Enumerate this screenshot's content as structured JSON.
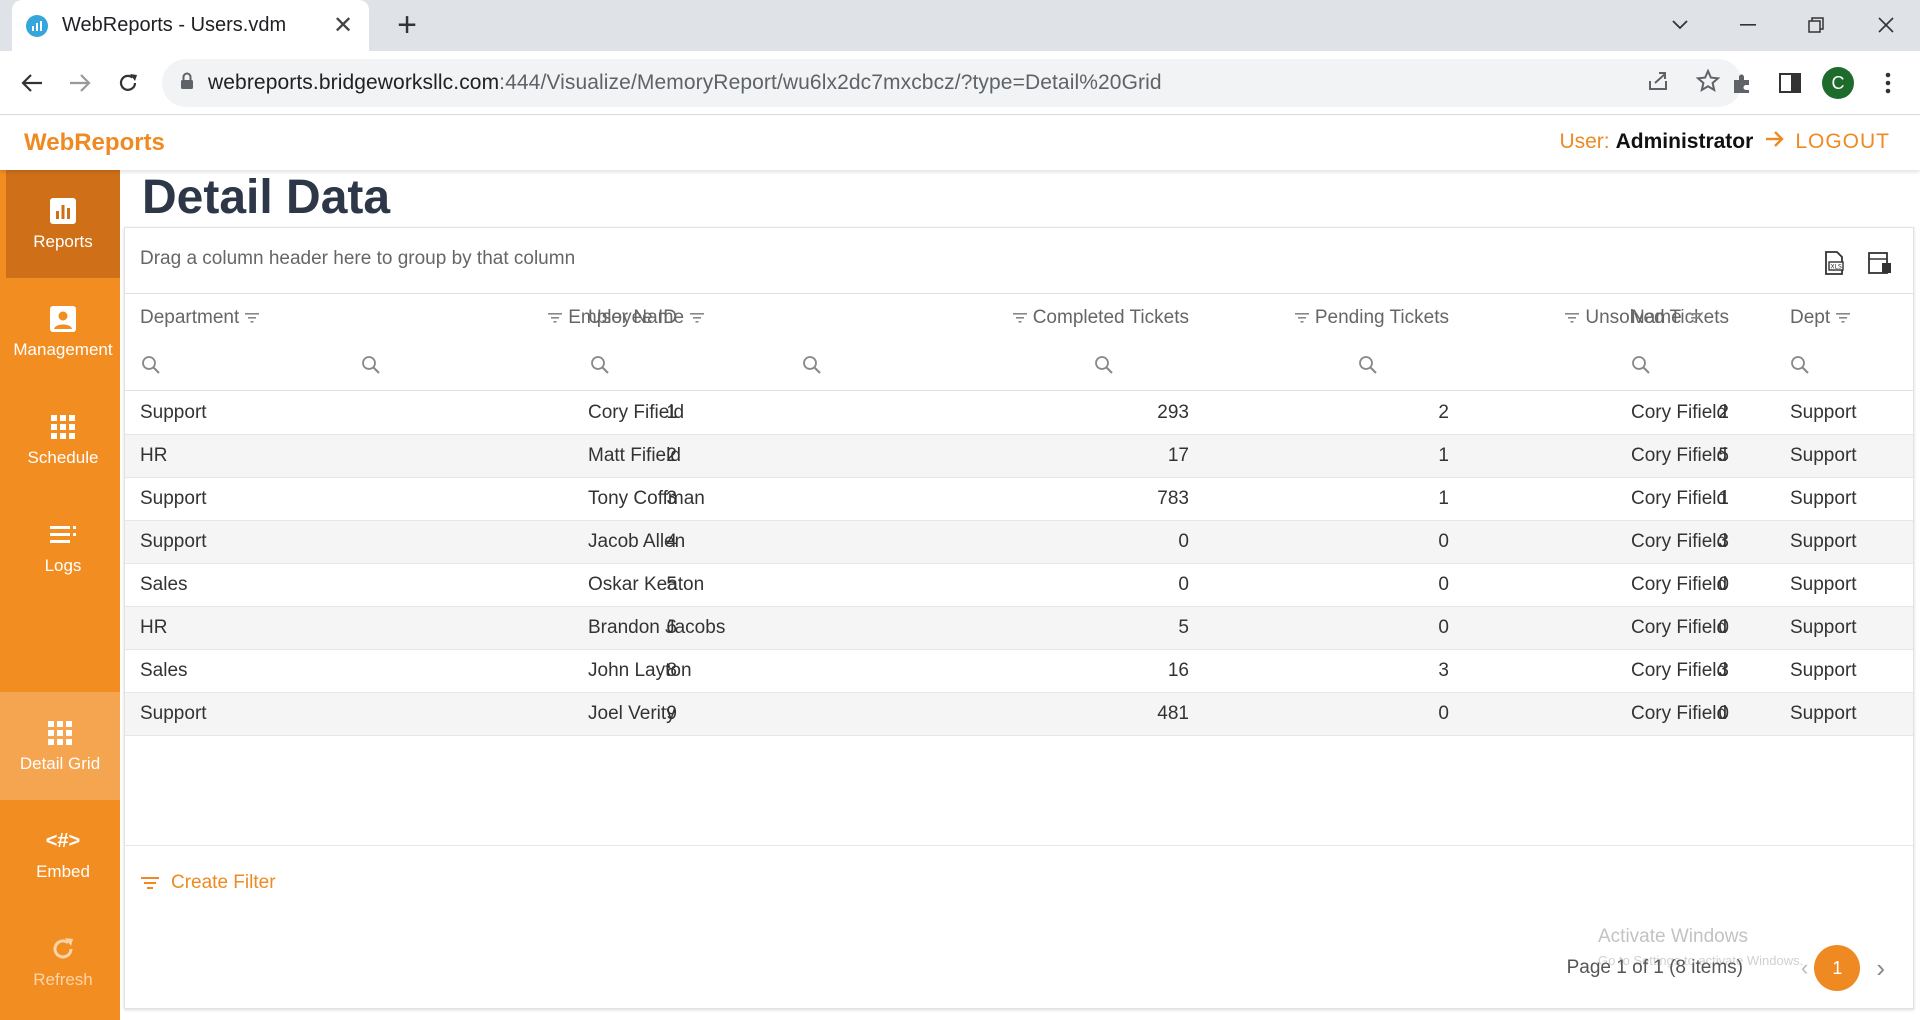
{
  "browser": {
    "tab_title": "WebReports - Users.vdm",
    "url_host": "webreports.bridgeworksllc.com",
    "url_path": ":444/Visualize/MemoryReport/wu6lx2dc7mxcbcz/?type=Detail%20Grid",
    "profile_initial": "C"
  },
  "app": {
    "brand": "WebReports",
    "user_label": "User:",
    "user_name": "Administrator",
    "logout_label": "LOGOUT"
  },
  "sidebar": {
    "items": [
      {
        "label": "Reports",
        "icon": "bar-chart-icon"
      },
      {
        "label": "Management",
        "icon": "account-box-icon"
      },
      {
        "label": "Schedule",
        "icon": "grid-icon"
      },
      {
        "label": "Logs",
        "icon": "list-icon"
      },
      {
        "label": "Detail Grid",
        "icon": "grid-icon"
      },
      {
        "label": "Embed",
        "icon": "embed-code-icon"
      },
      {
        "label": "Refresh",
        "icon": "refresh-icon"
      }
    ]
  },
  "page": {
    "title": "Detail Data"
  },
  "grid": {
    "group_panel_text": "Drag a column header here to group by that column",
    "columns": [
      "Department",
      "Employee ID",
      "User Name",
      "Completed Tickets",
      "Pending Tickets",
      "Unsolved Tickets",
      "Name",
      "Dept"
    ],
    "rows": [
      [
        "Support",
        "1",
        "Cory Fifield",
        "293",
        "2",
        "2",
        "Cory Fifield",
        "Support"
      ],
      [
        "HR",
        "2",
        "Matt Fifield",
        "17",
        "1",
        "5",
        "Cory Fifield",
        "Support"
      ],
      [
        "Support",
        "3",
        "Tony Coffman",
        "783",
        "1",
        "1",
        "Cory Fifield",
        "Support"
      ],
      [
        "Support",
        "4",
        "Jacob Allen",
        "0",
        "0",
        "3",
        "Cory Fifield",
        "Support"
      ],
      [
        "Sales",
        "5",
        "Oskar Keaton",
        "0",
        "0",
        "0",
        "Cory Fifield",
        "Support"
      ],
      [
        "HR",
        "6",
        "Brandon Jacobs",
        "5",
        "0",
        "0",
        "Cory Fifield",
        "Support"
      ],
      [
        "Sales",
        "8",
        "John Layton",
        "16",
        "3",
        "3",
        "Cory Fifield",
        "Support"
      ],
      [
        "Support",
        "9",
        "Joel Verity",
        "481",
        "0",
        "0",
        "Cory Fifield",
        "Support"
      ]
    ],
    "create_filter_label": "Create Filter",
    "pager_info": "Page 1 of 1 (8 items)",
    "current_page": "1"
  },
  "watermark": {
    "title": "Activate Windows",
    "subtitle": "Go to Settings to activate Windows."
  },
  "colors": {
    "accent": "#ef8a23",
    "sidebar": "#f28d22",
    "sidebar_active": "#cf6f18"
  }
}
